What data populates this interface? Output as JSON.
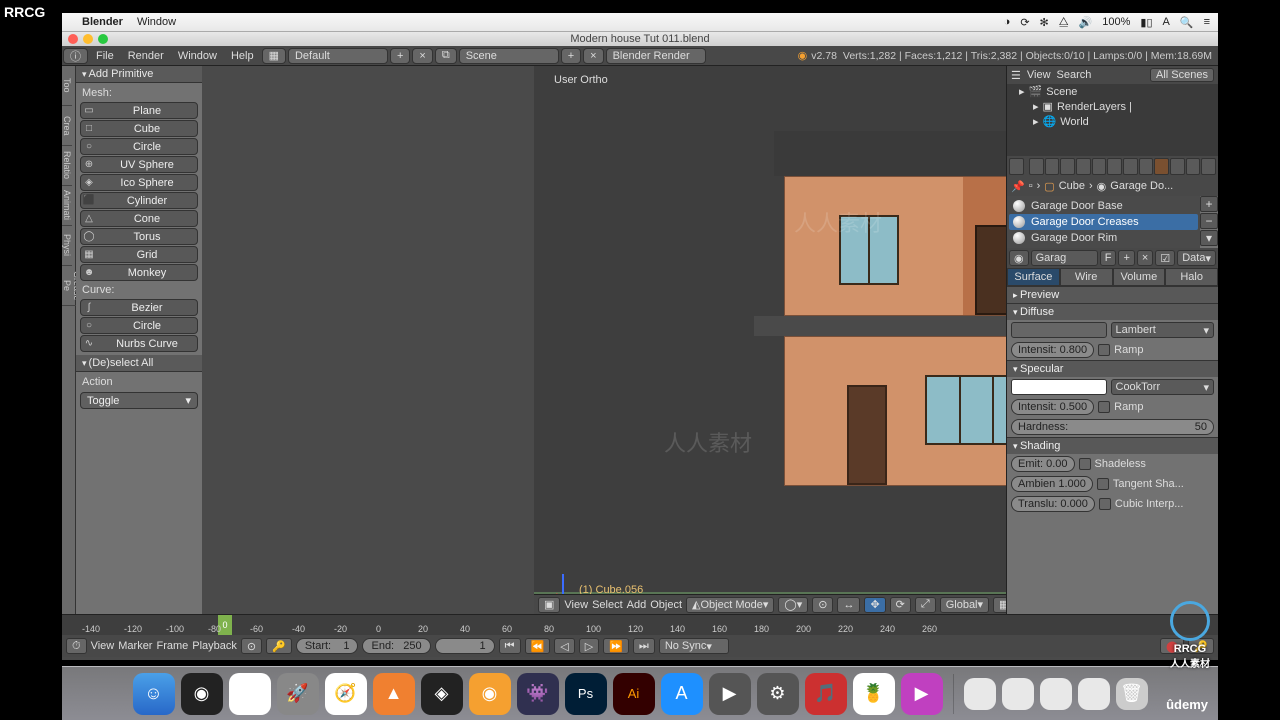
{
  "macos": {
    "app": "Blender",
    "menu2": "Window",
    "battery": "100%",
    "time": ""
  },
  "title": "Modern house Tut 011.blend",
  "menus": {
    "file": "File",
    "render": "Render",
    "window": "Window",
    "help": "Help"
  },
  "header": {
    "layout": "Default",
    "scene": "Scene",
    "engine": "Blender Render",
    "version": "v2.78",
    "stats": "Verts:1,282 | Faces:1,212 | Tris:2,382 | Objects:0/10 | Lamps:0/0 | Mem:18.69M"
  },
  "leftTabs": [
    "Too",
    "Crea",
    "Relatio",
    "Animati",
    "Physi",
    "Grease Pe"
  ],
  "addPrimitive": {
    "title": "Add Primitive",
    "meshLabel": "Mesh:",
    "mesh": [
      {
        "icon": "▭",
        "name": "Plane"
      },
      {
        "icon": "□",
        "name": "Cube"
      },
      {
        "icon": "○",
        "name": "Circle"
      },
      {
        "icon": "⊕",
        "name": "UV Sphere"
      },
      {
        "icon": "◈",
        "name": "Ico Sphere"
      },
      {
        "icon": "⬛",
        "name": "Cylinder"
      },
      {
        "icon": "△",
        "name": "Cone"
      },
      {
        "icon": "◯",
        "name": "Torus"
      },
      {
        "icon": "▦",
        "name": "Grid"
      },
      {
        "icon": "☻",
        "name": "Monkey"
      }
    ],
    "curveLabel": "Curve:",
    "curve": [
      {
        "icon": "∫",
        "name": "Bezier"
      },
      {
        "icon": "○",
        "name": "Circle"
      },
      {
        "icon": "∿",
        "name": "Nurbs Curve"
      }
    ]
  },
  "deselectAll": {
    "title": "(De)select All",
    "actionLabel": "Action",
    "action": "Toggle"
  },
  "viewport": {
    "label": "User Ortho",
    "object": "(1) Cube.056"
  },
  "vpFooter": {
    "view": "View",
    "select": "Select",
    "add": "Add",
    "object": "Object",
    "mode": "Object Mode",
    "orient": "Global"
  },
  "outliner": {
    "view": "View",
    "search": "Search",
    "filter": "All Scenes",
    "items": [
      {
        "icon": "🎬",
        "name": "Scene",
        "indent": 0
      },
      {
        "icon": "▣",
        "name": "RenderLayers  |",
        "indent": 1
      },
      {
        "icon": "🌐",
        "name": "World",
        "indent": 1
      }
    ]
  },
  "breadcrumb": {
    "obj": "Cube",
    "mat": "Garage Do..."
  },
  "materials": {
    "list": [
      "Garage Door Base",
      "Garage Door Creases",
      "Garage Door Rim"
    ],
    "selected": 1
  },
  "idrow": {
    "name": "Garag",
    "users": "F",
    "data": "Data"
  },
  "matTabs": [
    "Surface",
    "Wire",
    "Volume",
    "Halo"
  ],
  "preview": "Preview",
  "diffuse": {
    "title": "Diffuse",
    "intLabel": "Intensit:",
    "intVal": "0.800",
    "shader": "Lambert",
    "ramp": "Ramp"
  },
  "specular": {
    "title": "Specular",
    "intLabel": "Intensit:",
    "intVal": "0.500",
    "shader": "CookTorr",
    "ramp": "Ramp",
    "hardLabel": "Hardness:",
    "hardVal": "50"
  },
  "shading": {
    "title": "Shading",
    "emit": "Emit:",
    "emitVal": "0.00",
    "shadeless": "Shadeless",
    "amb": "Ambien",
    "ambVal": "1.000",
    "tangent": "Tangent Sha...",
    "trans": "Translu:",
    "transVal": "0.000",
    "cubic": "Cubic Interp..."
  },
  "timeline": {
    "ticks": [
      "-140",
      "-120",
      "-100",
      "-80",
      "-60",
      "-40",
      "-20",
      "0",
      "20",
      "40",
      "60",
      "80",
      "100",
      "120",
      "140",
      "160",
      "180",
      "200",
      "220",
      "240",
      "260"
    ],
    "view": "View",
    "marker": "Marker",
    "frame": "Frame",
    "playback": "Playback",
    "start": "Start:",
    "startVal": "1",
    "end": "End:",
    "endVal": "250",
    "cur": "1",
    "sync": "No Sync"
  },
  "watermark": "人人素材",
  "brandTL": "RRCG",
  "brandBR": "RRCG",
  "udemy": "ûdemy"
}
